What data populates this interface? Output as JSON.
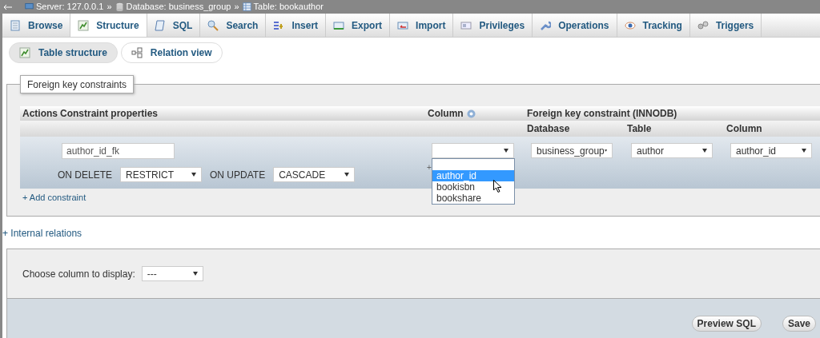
{
  "breadcrumb": [
    {
      "kind": "server",
      "label": "Server: 127.0.0.1"
    },
    {
      "kind": "database",
      "label": "Database: business_group"
    },
    {
      "kind": "table",
      "label": "Table: bookauthor"
    }
  ],
  "breadcrumb_separator": "»",
  "tabs": [
    {
      "kind": "browse",
      "label": "Browse",
      "selected": false
    },
    {
      "kind": "structure",
      "label": "Structure",
      "selected": true
    },
    {
      "kind": "sql",
      "label": "SQL",
      "selected": false
    },
    {
      "kind": "search",
      "label": "Search",
      "selected": false
    },
    {
      "kind": "insert",
      "label": "Insert",
      "selected": false
    },
    {
      "kind": "export",
      "label": "Export",
      "selected": false
    },
    {
      "kind": "import",
      "label": "Import",
      "selected": false
    },
    {
      "kind": "privileges",
      "label": "Privileges",
      "selected": false
    },
    {
      "kind": "operations",
      "label": "Operations",
      "selected": false
    },
    {
      "kind": "tracking",
      "label": "Tracking",
      "selected": false
    },
    {
      "kind": "triggers",
      "label": "Triggers",
      "selected": false
    }
  ],
  "subtabs": [
    {
      "kind": "structure",
      "label": "Table structure",
      "selected": true
    },
    {
      "kind": "relation",
      "label": "Relation view",
      "selected": false
    }
  ],
  "foreign_keys": {
    "legend": "Foreign key constraints",
    "headers": {
      "actions": "Actions",
      "properties": "Constraint properties",
      "column": "Column",
      "foreign_key": "Foreign key constraint (INNODB)",
      "database": "Database",
      "table": "Table",
      "ref_column": "Column"
    },
    "row": {
      "constraint_name": "author_id_fk",
      "on_delete_label": "ON DELETE",
      "on_delete": "RESTRICT",
      "on_update_label": "ON UPDATE",
      "on_update": "CASCADE",
      "column_add_mark": "+",
      "database": "business_group",
      "table": "author",
      "ref_column": "author_id",
      "column_options": [
        {
          "label": "author_id",
          "selected": true
        },
        {
          "label": "bookisbn",
          "selected": false
        },
        {
          "label": "bookshare",
          "selected": false
        }
      ]
    },
    "add_constraint": "+ Add constraint"
  },
  "internal_relations": "+ Internal relations",
  "display_column": {
    "label": "Choose column to display:",
    "value": "---"
  },
  "buttons": [
    "Preview SQL",
    "Save"
  ]
}
